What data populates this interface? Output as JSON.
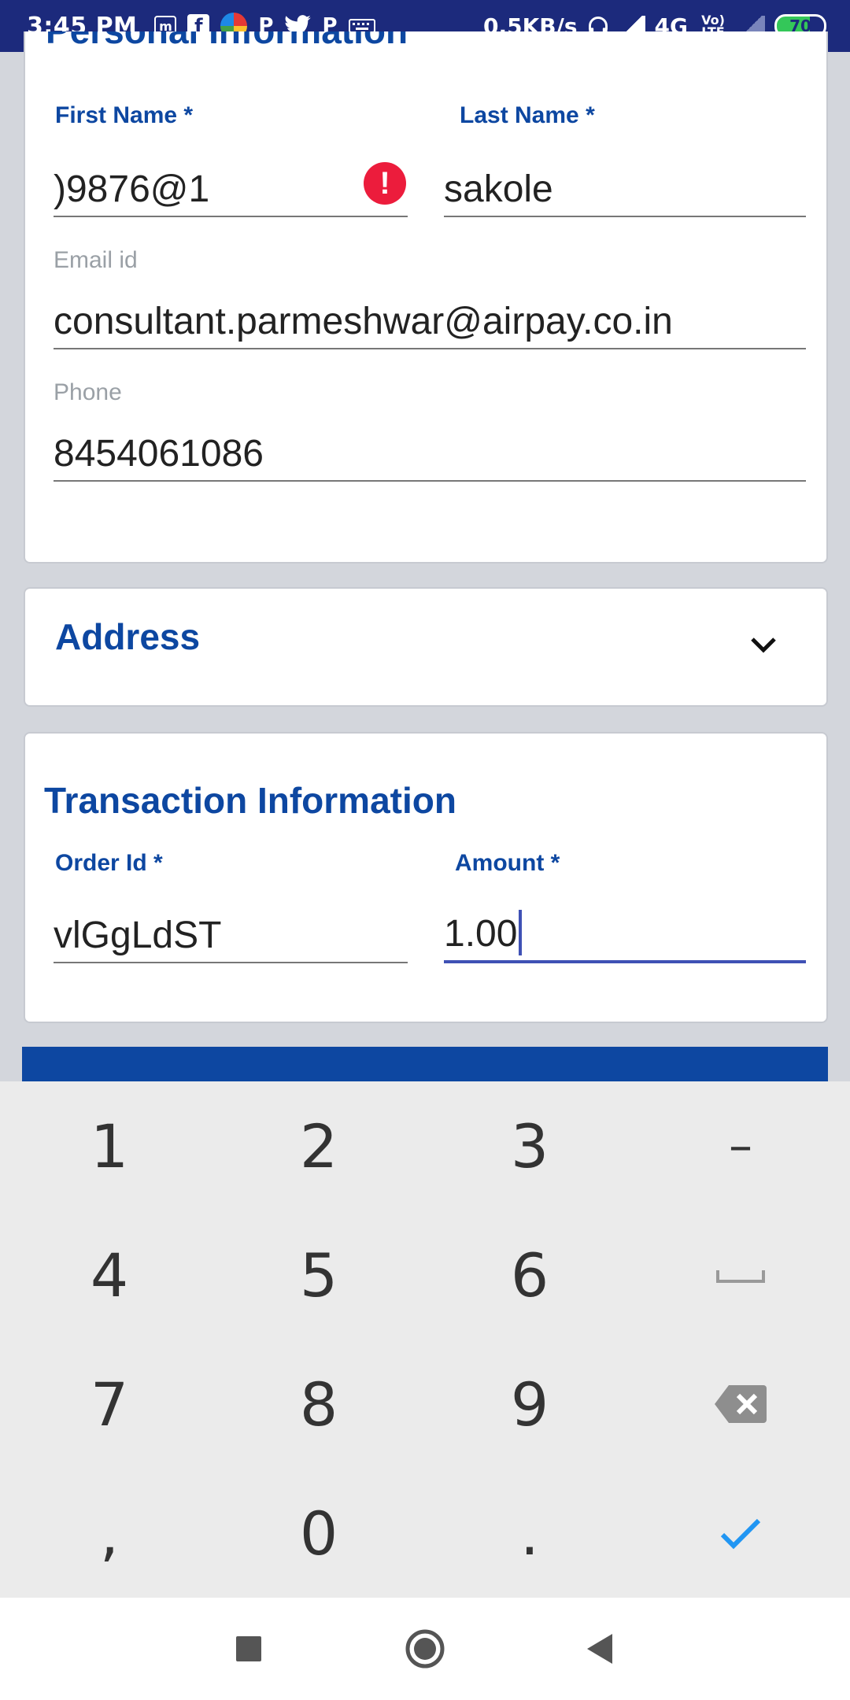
{
  "status_bar": {
    "time": "3:45 PM",
    "network_speed": "0.5KB/s",
    "network_type": "4G",
    "volte_label": "Vo) LTE",
    "battery": "70",
    "icons": [
      "messages-icon",
      "facebook-icon",
      "browser-icon",
      "paytm-icon",
      "twitter-icon",
      "paytm-icon",
      "keyboard-icon",
      "headset-icon",
      "signal-icon",
      "volte-icon",
      "signal-empty-icon",
      "battery-icon"
    ]
  },
  "personal_info": {
    "title": "Personal Information",
    "first_name_label": "First Name *",
    "first_name_value": ")9876@1",
    "first_name_error_icon": "!",
    "last_name_label": "Last Name *",
    "last_name_value": "sakole",
    "email_label": "Email id",
    "email_value": "consultant.parmeshwar@airpay.co.in",
    "phone_label": "Phone",
    "phone_value": "8454061086"
  },
  "address": {
    "title": "Address",
    "expand_icon": "chevron-down-icon"
  },
  "transaction_info": {
    "title": "Transaction Information",
    "order_id_label": "Order Id *",
    "order_id_value": "vlGgLdST",
    "amount_label": "Amount *",
    "amount_value": "1.00"
  },
  "keyboard": {
    "keys": [
      "1",
      "2",
      "3",
      "–",
      "4",
      "5",
      "6",
      "␣",
      "7",
      "8",
      "9",
      "⌫",
      ",",
      "0",
      ".",
      "✓"
    ]
  },
  "colors": {
    "brand_blue": "#0d47a1",
    "status_bar": "#1c2a7c",
    "error_red": "#ec1c3c",
    "focus_underline": "#3f51b5",
    "check_blue": "#2196f3"
  }
}
